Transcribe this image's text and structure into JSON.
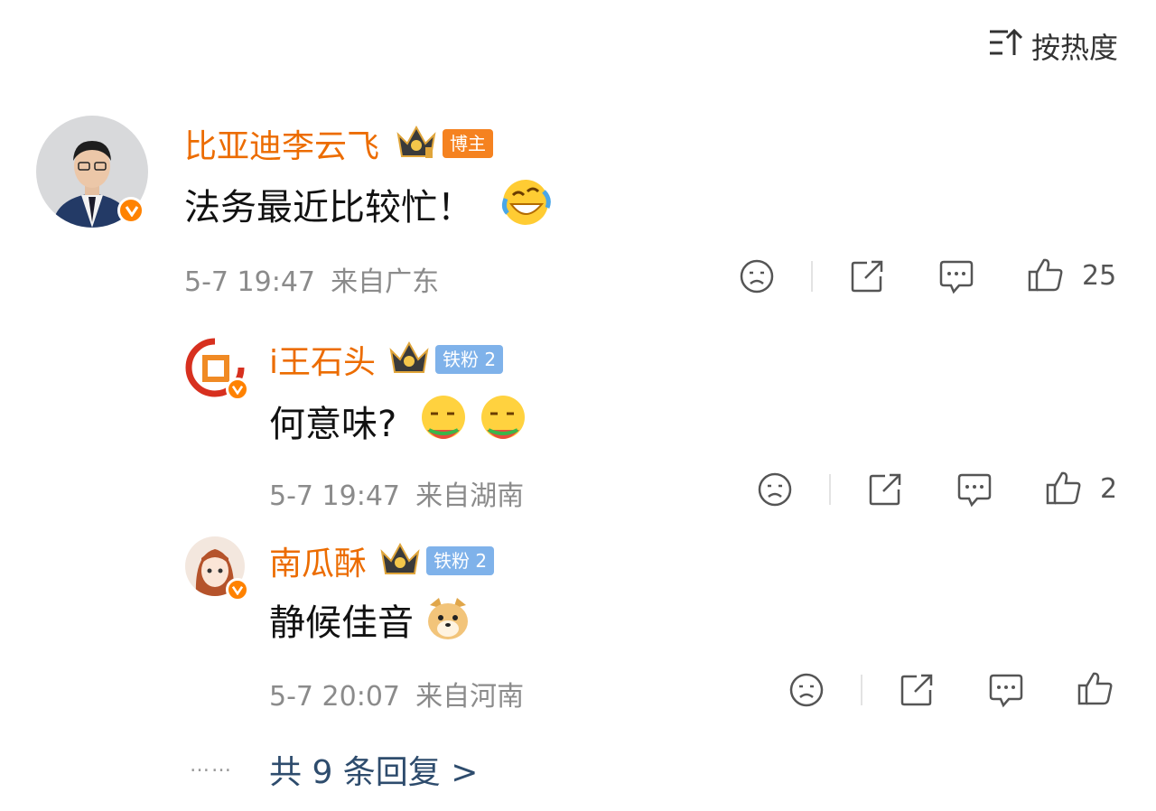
{
  "sort": {
    "label": "按热度",
    "icon": "sort-icon"
  },
  "comments": [
    {
      "username": "比亚迪李云飞",
      "badge": "博主",
      "text": "法务最近比较忙！",
      "emoji": "laughing-tears-emoji",
      "time": "5-7 19:47",
      "location": "来自广东",
      "likes": "25"
    }
  ],
  "replies": [
    {
      "username": "i王石头",
      "badge": "铁粉 2",
      "text": "何意味?",
      "emoji": "eating-melon-emoji",
      "time": "5-7 19:47",
      "location": "来自湖南",
      "likes": "2"
    },
    {
      "username": "南瓜酥",
      "badge": "铁粉 2",
      "text": "静候佳音",
      "emoji": "doge-emoji",
      "time": "5-7 20:07",
      "location": "来自河南",
      "likes": ""
    }
  ],
  "more_replies": {
    "dots": "……",
    "label": "共 9 条回复 >"
  },
  "colors": {
    "username": "#ec6c00",
    "blogger_tag": "#f58220",
    "fan_tag": "#7fb2ea",
    "verified": "#ff8200",
    "link": "#2e4c6d"
  }
}
